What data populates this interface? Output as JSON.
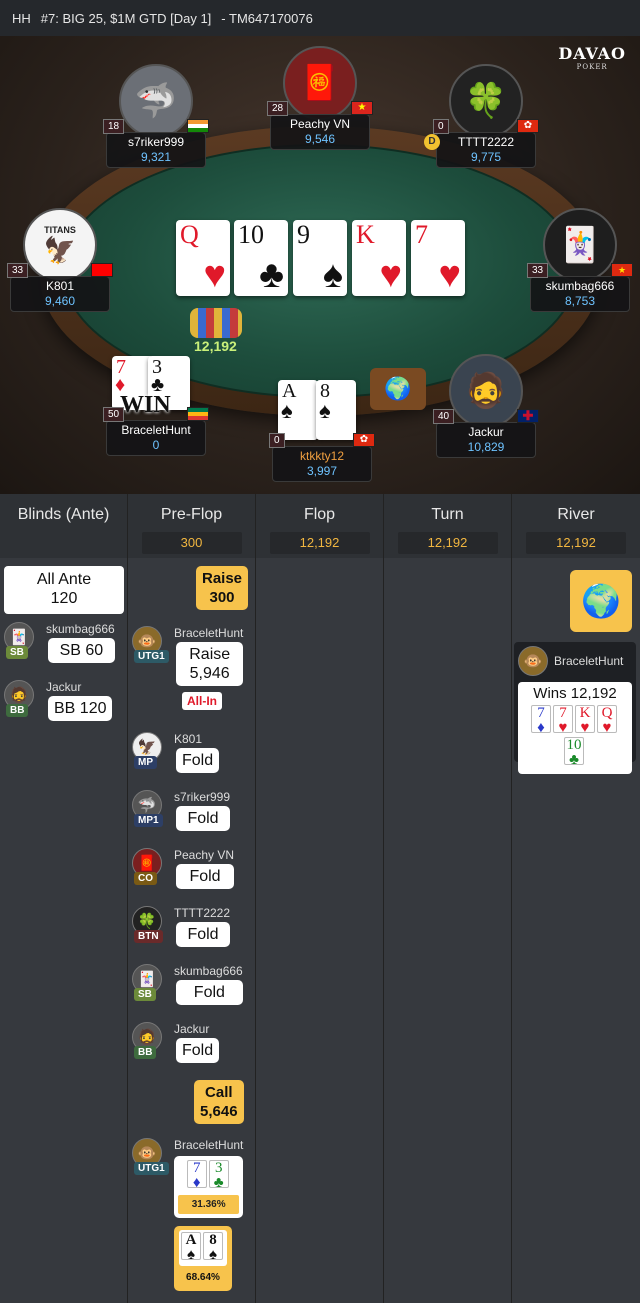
{
  "header": {
    "hh": "HH",
    "title": "#7: BIG 25, $1M GTD [Day 1]",
    "hand_id": "- TM647170076"
  },
  "brand": {
    "name": "DAVAO",
    "sub": "POKER"
  },
  "board": [
    {
      "rank": "Q",
      "suit": "♥",
      "color": "red"
    },
    {
      "rank": "10",
      "suit": "♣",
      "color": "blk"
    },
    {
      "rank": "9",
      "suit": "♠",
      "color": "blk"
    },
    {
      "rank": "K",
      "suit": "♥",
      "color": "red"
    },
    {
      "rank": "7",
      "suit": "♥",
      "color": "red"
    }
  ],
  "pot_on_table": "12,192",
  "seats": [
    {
      "name": "s7riker999",
      "stack": "9,321",
      "level": "18",
      "avatar": "🦈"
    },
    {
      "name": "Peachy VN",
      "stack": "9,546",
      "level": "28",
      "avatar": "🧧"
    },
    {
      "name": "TTTT2222",
      "stack": "9,775",
      "level": "0",
      "avatar": "🍀"
    },
    {
      "name": "K801",
      "stack": "9,460",
      "level": "33",
      "avatar": "🦅",
      "avatar_text": "TITANS"
    },
    {
      "name": "skumbag666",
      "stack": "8,753",
      "level": "33",
      "avatar": "🃏"
    },
    {
      "name": "BraceletHunt",
      "stack": "0",
      "level": "50",
      "avatar": "",
      "win": "WIN"
    },
    {
      "name": "ktkkty12",
      "stack": "3,997",
      "level": "0",
      "avatar": ""
    },
    {
      "name": "Jackur",
      "stack": "10,829",
      "level": "40",
      "avatar": "🧔"
    }
  ],
  "hole_cards": {
    "bracelethunt": [
      {
        "rank": "7",
        "suit": "♦"
      },
      {
        "rank": "3",
        "suit": "♣"
      }
    ],
    "ktkkty12": [
      {
        "rank": "A",
        "suit": "♠"
      },
      {
        "rank": "8",
        "suit": "♠"
      }
    ]
  },
  "dealer_label": "D",
  "streets": [
    {
      "name": "Blinds (Ante)",
      "pot": ""
    },
    {
      "name": "Pre-Flop",
      "pot": "300"
    },
    {
      "name": "Flop",
      "pot": "12,192"
    },
    {
      "name": "Turn",
      "pot": "12,192"
    },
    {
      "name": "River",
      "pot": "12,192"
    }
  ],
  "blinds": {
    "ante_label": "All Ante",
    "ante_value": "120",
    "sb": {
      "name": "skumbag666",
      "pos": "SB",
      "action": "SB 60"
    },
    "bb": {
      "name": "Jackur",
      "pos": "BB",
      "action": "BB 120"
    }
  },
  "preflop": {
    "hero_raise": {
      "label": "Raise",
      "value": "300"
    },
    "actions": [
      {
        "name": "BraceletHunt",
        "pos": "UTG1",
        "action": "Raise",
        "amount": "5,946",
        "allin": "All-In"
      },
      {
        "name": "K801",
        "pos": "MP",
        "action": "Fold"
      },
      {
        "name": "s7riker999",
        "pos": "MP1",
        "action": "Fold"
      },
      {
        "name": "Peachy VN",
        "pos": "CO",
        "action": "Fold"
      },
      {
        "name": "TTTT2222",
        "pos": "BTN",
        "action": "Fold"
      },
      {
        "name": "skumbag666",
        "pos": "SB",
        "action": "Fold"
      },
      {
        "name": "Jackur",
        "pos": "BB",
        "action": "Fold"
      }
    ],
    "hero_call": {
      "label": "Call",
      "value": "5,646"
    },
    "showdown": {
      "name": "BraceletHunt",
      "pos": "UTG1",
      "equity": "31.36%",
      "hero_equity": "68.64%"
    }
  },
  "river": {
    "winner": "BraceletHunt",
    "wins_text": "Wins 12,192",
    "hand": [
      {
        "rank": "7",
        "suit": "♦"
      },
      {
        "rank": "7",
        "suit": "♥"
      },
      {
        "rank": "K",
        "suit": "♥"
      },
      {
        "rank": "Q",
        "suit": "♥"
      },
      {
        "rank": "10",
        "suit": "♣"
      }
    ]
  },
  "colors": {
    "gold": "#f7c34c",
    "stack_blue": "#6ec3ff",
    "pot_orange": "#f1b640"
  }
}
